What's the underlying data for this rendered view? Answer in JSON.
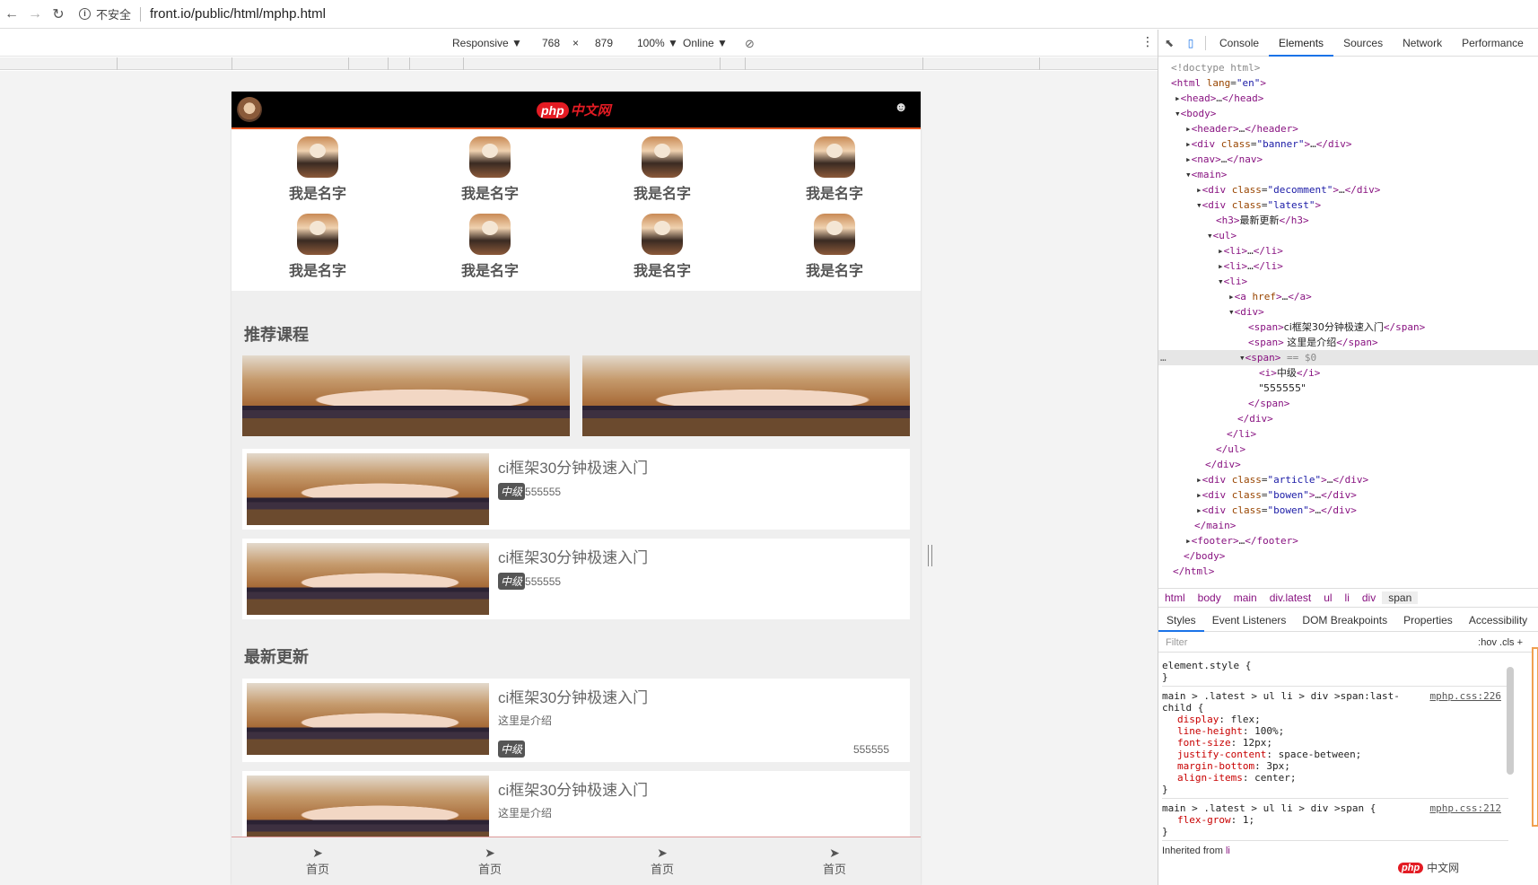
{
  "browser": {
    "security_label": "不安全",
    "url": "front.io/public/html/mphp.html"
  },
  "device_toolbar": {
    "device": "Responsive ▼",
    "width": "768",
    "times": "×",
    "height": "879",
    "zoom": "100% ▼",
    "network": "Online ▼"
  },
  "mobile": {
    "logo_php": "php",
    "logo_cn": "中文网",
    "nav_items": [
      "我是名字",
      "我是名字",
      "我是名字",
      "我是名字",
      "我是名字",
      "我是名字",
      "我是名字",
      "我是名字"
    ],
    "recommend_title": "推荐课程",
    "recommend_cards": [
      {
        "title": "ci框架30分钟极速入门",
        "level": "中级",
        "count": "555555"
      },
      {
        "title": "ci框架30分钟极速入门",
        "level": "中级",
        "count": "555555"
      }
    ],
    "latest_title": "最新更新",
    "latest_cards": [
      {
        "title": "ci框架30分钟极速入门",
        "intro": "这里是介绍",
        "level": "中级",
        "count": "555555"
      },
      {
        "title": "ci框架30分钟极速入门",
        "intro": "这里是介绍"
      }
    ],
    "tabbar": [
      "首页",
      "首页",
      "首页",
      "首页"
    ]
  },
  "devtools": {
    "tabs": [
      "Console",
      "Elements",
      "Sources",
      "Network",
      "Performance"
    ],
    "active_tab": "Elements",
    "breadcrumbs": [
      "html",
      "body",
      "main",
      "div.latest",
      "ul",
      "li",
      "div",
      "span"
    ],
    "sub_tabs": [
      "Styles",
      "Event Listeners",
      "DOM Breakpoints",
      "Properties",
      "Accessibility"
    ],
    "filter_placeholder": "Filter",
    "filter_controls": ":hov  .cls  +",
    "element_style": "element.style {",
    "rule1_selector": "main > .latest > ul li > div >span:last-child {",
    "rule1_source": "mphp.css:226",
    "rule1_props": [
      [
        "display",
        "flex;"
      ],
      [
        "line-height",
        "100%;"
      ],
      [
        "font-size",
        "12px;"
      ],
      [
        "justify-content",
        "space-between;"
      ],
      [
        "margin-bottom",
        "3px;"
      ],
      [
        "align-items",
        "center;"
      ]
    ],
    "rule2_selector": "main > .latest > ul li > div >span {",
    "rule2_source": "mphp.css:212",
    "rule2_props": [
      [
        "flex-grow",
        "1;"
      ]
    ],
    "inherited": "Inherited from",
    "inherited_el": "li"
  },
  "watermark": {
    "p": "php",
    "text": "中文网"
  }
}
